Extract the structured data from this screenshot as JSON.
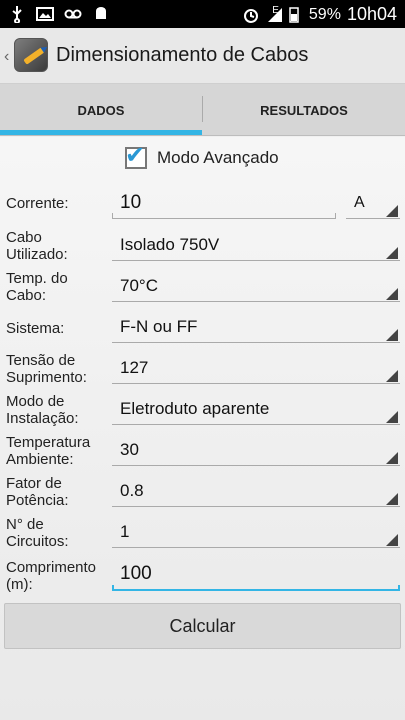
{
  "status": {
    "battery": "59%",
    "time": "10h04",
    "network": "E"
  },
  "app": {
    "title": "Dimensionamento de Cabos"
  },
  "tabs": [
    {
      "label": "DADOS"
    },
    {
      "label": "RESULTADOS"
    }
  ],
  "advanced": {
    "label": "Modo Avançado",
    "checked": true
  },
  "form": {
    "corrente": {
      "label": "Corrente:",
      "value": "10",
      "unit": "A"
    },
    "cabo": {
      "label": "Cabo Utilizado:",
      "value": "Isolado 750V"
    },
    "temp_cabo": {
      "label": "Temp. do Cabo:",
      "value": "70°C"
    },
    "sistema": {
      "label": "Sistema:",
      "value": "F-N ou FF"
    },
    "tensao": {
      "label": "Tensão de Suprimento:",
      "value": "127"
    },
    "instalacao": {
      "label": "Modo de Instalação:",
      "value": "Eletroduto aparente"
    },
    "temperatura": {
      "label": "Temperatura Ambiente:",
      "value": "30"
    },
    "fator": {
      "label": "Fator de Potência:",
      "value": "0.8"
    },
    "circuitos": {
      "label": "N° de Circuitos:",
      "value": "1"
    },
    "comprimento": {
      "label": "Comprimento (m):",
      "value": "100"
    }
  },
  "actions": {
    "calculate": "Calcular"
  },
  "colors": {
    "accent": "#33b5e5"
  }
}
